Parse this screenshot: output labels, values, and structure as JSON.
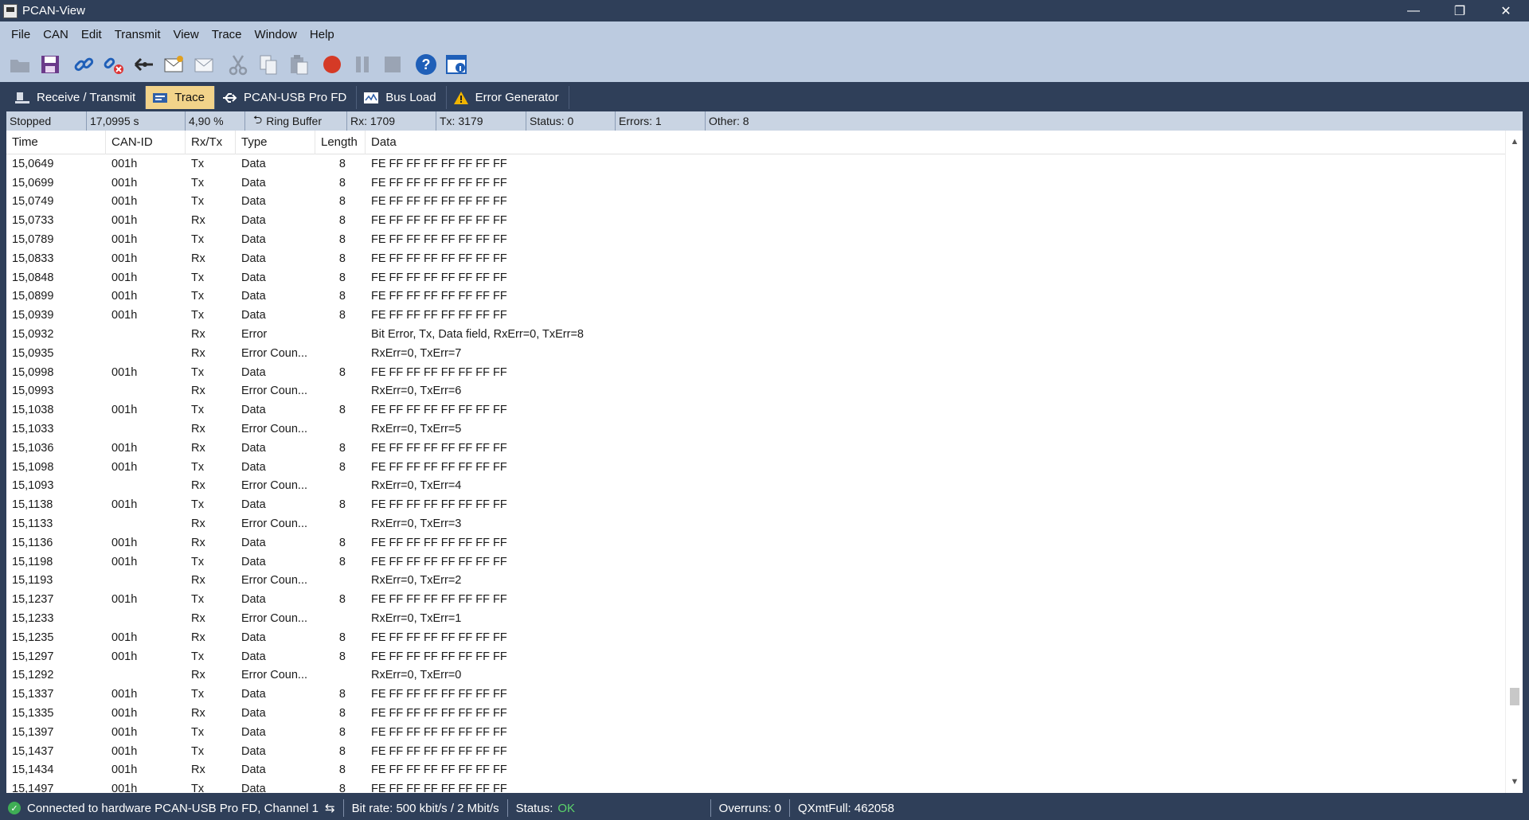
{
  "window": {
    "title": "PCAN-View",
    "controls": [
      "—",
      "❐",
      "✕"
    ]
  },
  "menu": [
    "File",
    "CAN",
    "Edit",
    "Transmit",
    "View",
    "Trace",
    "Window",
    "Help"
  ],
  "tabs": [
    {
      "label": "Receive / Transmit",
      "icon": "receive-transmit-icon"
    },
    {
      "label": "Trace",
      "icon": "trace-icon",
      "active": true
    },
    {
      "label": "PCAN-USB Pro FD",
      "icon": "usb-icon"
    },
    {
      "label": "Bus Load",
      "icon": "bus-load-icon"
    },
    {
      "label": "Error Generator",
      "icon": "warning-icon"
    }
  ],
  "infobar": {
    "state": "Stopped",
    "time": "17,0995 s",
    "percent": "4,90 %",
    "buffer": "Ring Buffer",
    "rx": "Rx: 1709",
    "tx": "Tx: 3179",
    "status": "Status: 0",
    "errors": "Errors: 1",
    "other": "Other: 8"
  },
  "columns": {
    "time": "Time",
    "id": "CAN-ID",
    "rxtx": "Rx/Tx",
    "type": "Type",
    "length": "Length",
    "data": "Data"
  },
  "rows": [
    [
      "15,0649",
      "001h",
      "Tx",
      "Data",
      "8",
      "FE FF FF FF FF FF FF FF"
    ],
    [
      "15,0699",
      "001h",
      "Tx",
      "Data",
      "8",
      "FE FF FF FF FF FF FF FF"
    ],
    [
      "15,0749",
      "001h",
      "Tx",
      "Data",
      "8",
      "FE FF FF FF FF FF FF FF"
    ],
    [
      "15,0733",
      "001h",
      "Rx",
      "Data",
      "8",
      "FE FF FF FF FF FF FF FF"
    ],
    [
      "15,0789",
      "001h",
      "Tx",
      "Data",
      "8",
      "FE FF FF FF FF FF FF FF"
    ],
    [
      "15,0833",
      "001h",
      "Rx",
      "Data",
      "8",
      "FE FF FF FF FF FF FF FF"
    ],
    [
      "15,0848",
      "001h",
      "Tx",
      "Data",
      "8",
      "FE FF FF FF FF FF FF FF"
    ],
    [
      "15,0899",
      "001h",
      "Tx",
      "Data",
      "8",
      "FE FF FF FF FF FF FF FF"
    ],
    [
      "15,0939",
      "001h",
      "Tx",
      "Data",
      "8",
      "FE FF FF FF FF FF FF FF"
    ],
    [
      "15,0932",
      "",
      "Rx",
      "Error",
      "",
      "Bit Error, Tx, Data field, RxErr=0, TxErr=8"
    ],
    [
      "15,0935",
      "",
      "Rx",
      "Error Coun...",
      "",
      "RxErr=0, TxErr=7"
    ],
    [
      "15,0998",
      "001h",
      "Tx",
      "Data",
      "8",
      "FE FF FF FF FF FF FF FF"
    ],
    [
      "15,0993",
      "",
      "Rx",
      "Error Coun...",
      "",
      "RxErr=0, TxErr=6"
    ],
    [
      "15,1038",
      "001h",
      "Tx",
      "Data",
      "8",
      "FE FF FF FF FF FF FF FF"
    ],
    [
      "15,1033",
      "",
      "Rx",
      "Error Coun...",
      "",
      "RxErr=0, TxErr=5"
    ],
    [
      "15,1036",
      "001h",
      "Rx",
      "Data",
      "8",
      "FE FF FF FF FF FF FF FF"
    ],
    [
      "15,1098",
      "001h",
      "Tx",
      "Data",
      "8",
      "FE FF FF FF FF FF FF FF"
    ],
    [
      "15,1093",
      "",
      "Rx",
      "Error Coun...",
      "",
      "RxErr=0, TxErr=4"
    ],
    [
      "15,1138",
      "001h",
      "Tx",
      "Data",
      "8",
      "FE FF FF FF FF FF FF FF"
    ],
    [
      "15,1133",
      "",
      "Rx",
      "Error Coun...",
      "",
      "RxErr=0, TxErr=3"
    ],
    [
      "15,1136",
      "001h",
      "Rx",
      "Data",
      "8",
      "FE FF FF FF FF FF FF FF"
    ],
    [
      "15,1198",
      "001h",
      "Tx",
      "Data",
      "8",
      "FE FF FF FF FF FF FF FF"
    ],
    [
      "15,1193",
      "",
      "Rx",
      "Error Coun...",
      "",
      "RxErr=0, TxErr=2"
    ],
    [
      "15,1237",
      "001h",
      "Tx",
      "Data",
      "8",
      "FE FF FF FF FF FF FF FF"
    ],
    [
      "15,1233",
      "",
      "Rx",
      "Error Coun...",
      "",
      "RxErr=0, TxErr=1"
    ],
    [
      "15,1235",
      "001h",
      "Rx",
      "Data",
      "8",
      "FE FF FF FF FF FF FF FF"
    ],
    [
      "15,1297",
      "001h",
      "Tx",
      "Data",
      "8",
      "FE FF FF FF FF FF FF FF"
    ],
    [
      "15,1292",
      "",
      "Rx",
      "Error Coun...",
      "",
      "RxErr=0, TxErr=0"
    ],
    [
      "15,1337",
      "001h",
      "Tx",
      "Data",
      "8",
      "FE FF FF FF FF FF FF FF"
    ],
    [
      "15,1335",
      "001h",
      "Rx",
      "Data",
      "8",
      "FE FF FF FF FF FF FF FF"
    ],
    [
      "15,1397",
      "001h",
      "Tx",
      "Data",
      "8",
      "FE FF FF FF FF FF FF FF"
    ],
    [
      "15,1437",
      "001h",
      "Tx",
      "Data",
      "8",
      "FE FF FF FF FF FF FF FF"
    ],
    [
      "15,1434",
      "001h",
      "Rx",
      "Data",
      "8",
      "FE FF FF FF FF FF FF FF"
    ],
    [
      "15,1497",
      "001h",
      "Tx",
      "Data",
      "8",
      "FE FF FF FF FF FF FF FF"
    ]
  ],
  "statusbar": {
    "connection": "Connected to hardware PCAN-USB Pro FD, Channel 1",
    "bitrate": "Bit rate: 500 kbit/s / 2 Mbit/s",
    "status_label": "Status:",
    "status_value": "OK",
    "overruns": "Overruns: 0",
    "qxmtfull": "QXmtFull: 462058"
  },
  "colors": {
    "titlebar": "#2f3f59",
    "menubar": "#bccbe0",
    "active_tab": "#f2d38a",
    "ok": "#5cd46b"
  }
}
